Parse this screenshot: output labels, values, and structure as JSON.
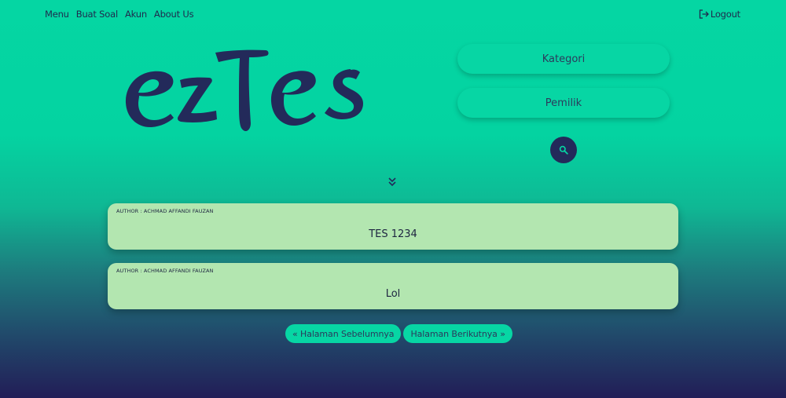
{
  "nav": {
    "items": [
      "Menu",
      "Buat Soal",
      "Akun",
      "About Us"
    ],
    "logout_label": "Logout"
  },
  "brand": {
    "logo_text": "ezTes",
    "color": "#232a5a"
  },
  "filters": {
    "kategori_label": "Kategori",
    "pemilik_label": "Pemilik"
  },
  "search": {
    "icon": "search-icon"
  },
  "expand": {
    "icon": "double-chevron-down-icon"
  },
  "quizzes": [
    {
      "author": "AUTHOR : ACHMAD AFFANDI FAUZAN",
      "title": "TES 1234"
    },
    {
      "author": "AUTHOR : ACHMAD AFFANDI FAUZAN",
      "title": "Lol"
    }
  ],
  "pagination": {
    "prev_label": "« Halaman Sebelumnya",
    "next_label": "Halaman Berikutnya »"
  },
  "colors": {
    "accent": "#05d6a3",
    "card": "#b3e6b0",
    "dark": "#232a5a"
  }
}
